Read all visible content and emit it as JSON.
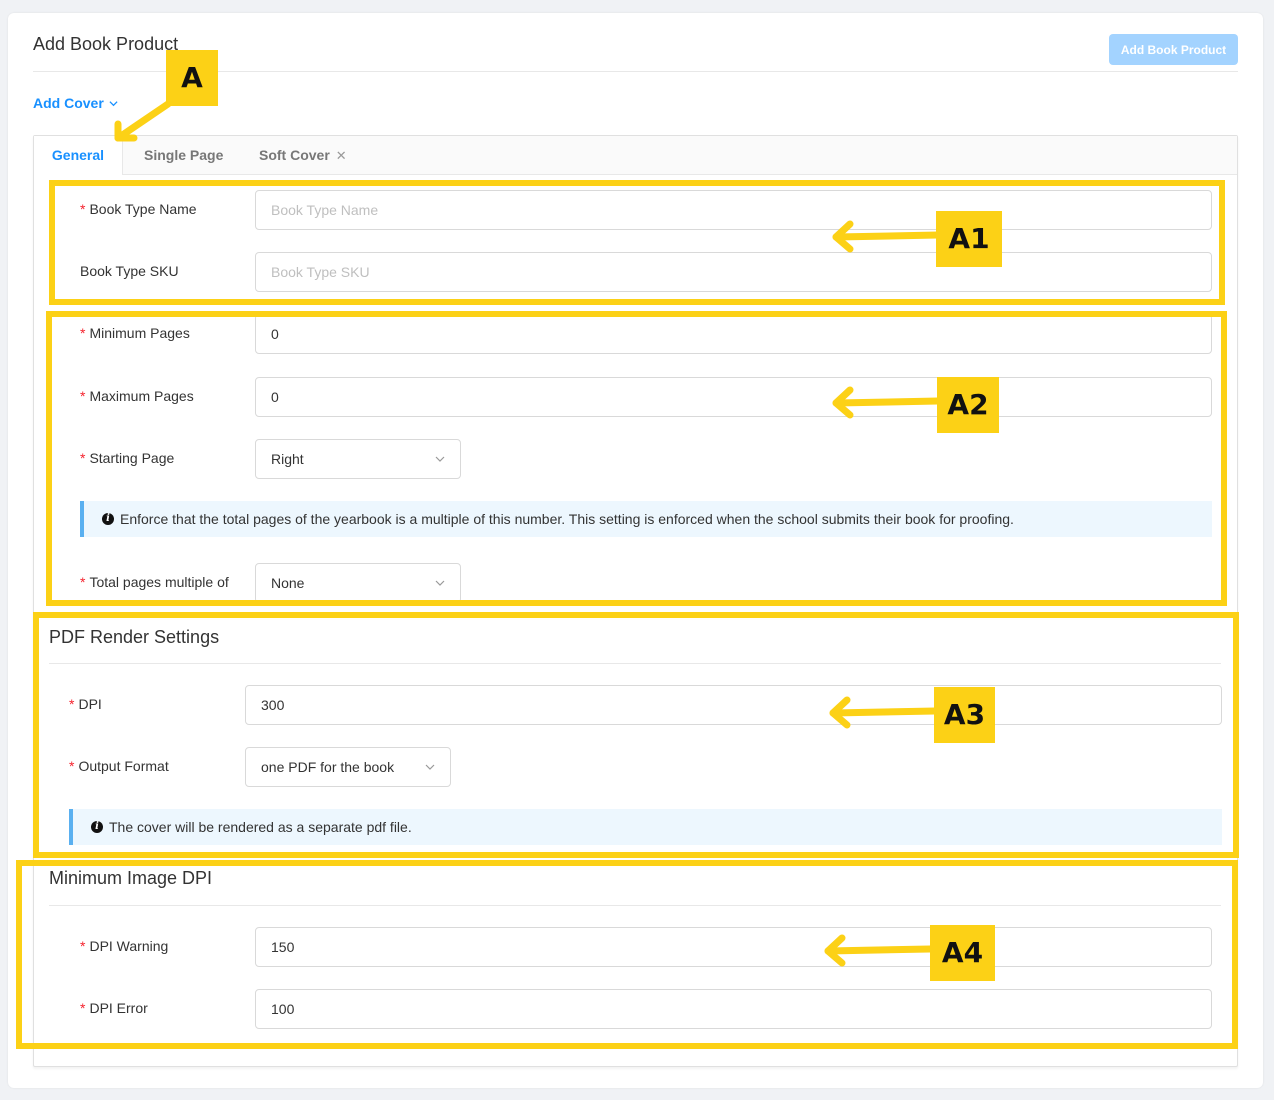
{
  "header": {
    "title": "Add Book Product",
    "primary_button": "Add Book Product"
  },
  "add_cover": {
    "label": "Add Cover"
  },
  "tabs": [
    {
      "label": "General",
      "active": true
    },
    {
      "label": "Single Page",
      "active": false
    },
    {
      "label": "Soft Cover",
      "active": false,
      "closable": true
    }
  ],
  "general": {
    "book_type_name": {
      "label": "Book Type Name",
      "placeholder": "Book Type Name",
      "required": true
    },
    "book_type_sku": {
      "label": "Book Type SKU",
      "placeholder": "Book Type SKU",
      "required": false
    },
    "minimum_pages": {
      "label": "Minimum Pages",
      "value": "0",
      "required": true
    },
    "maximum_pages": {
      "label": "Maximum Pages",
      "value": "0",
      "required": true
    },
    "starting_page": {
      "label": "Starting Page",
      "value": "Right",
      "required": true
    },
    "multiple_info": "Enforce that the total pages of the yearbook is a multiple of this number. This setting is enforced when the school submits their book for proofing.",
    "total_pages_multiple": {
      "label": "Total pages multiple of",
      "value": "None",
      "required": true
    }
  },
  "pdf_render": {
    "title": "PDF Render Settings",
    "dpi": {
      "label": "DPI",
      "value": "300",
      "required": true
    },
    "output_format": {
      "label": "Output Format",
      "value": "one PDF for the book",
      "required": true
    },
    "info": "The cover will be rendered as a separate pdf file."
  },
  "min_image_dpi": {
    "title": "Minimum Image DPI",
    "dpi_warning": {
      "label": "DPI Warning",
      "value": "150",
      "required": true
    },
    "dpi_error": {
      "label": "DPI Error",
      "value": "100",
      "required": true
    }
  },
  "annotations": {
    "tags": [
      "A",
      "A1",
      "A2",
      "A3",
      "A4"
    ],
    "highlight_color": "#fcd116"
  },
  "colors": {
    "accent": "#1890ff",
    "required": "#f5222d",
    "disabled_button": "#a3d3ff",
    "info_background": "#edf7fe"
  },
  "icons": {
    "dropdown": "chevron-down-icon",
    "info": "info-icon",
    "close": "close-icon"
  }
}
